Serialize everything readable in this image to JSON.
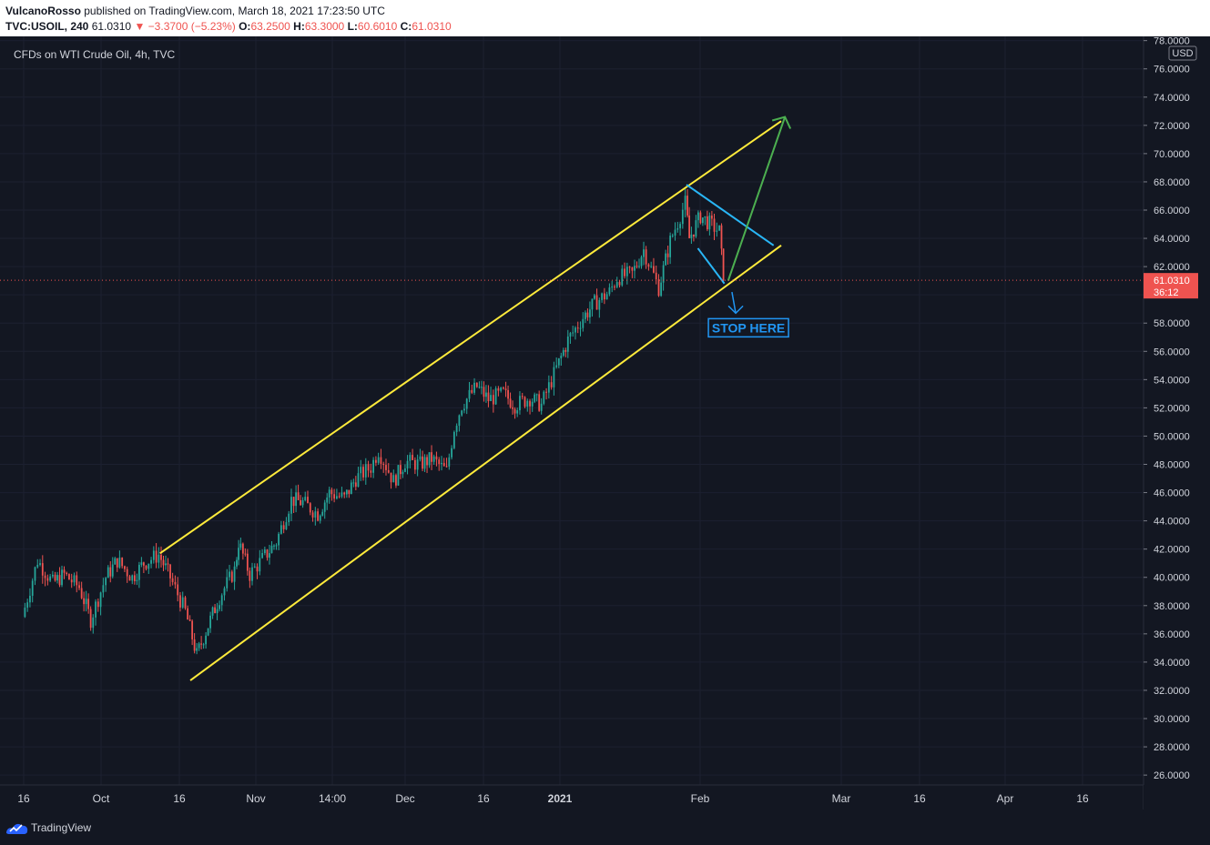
{
  "header": {
    "author": "VulcanoRosso",
    "published_text": "published on TradingView.com, March 18, 2021 17:23:50 UTC",
    "symbol": "TVC:USOIL, 240",
    "last": "61.0310",
    "change": "−3.3700 (−5.23%)",
    "o_label": "O:",
    "o": "63.2500",
    "h_label": "H:",
    "h": "63.3000",
    "l_label": "L:",
    "l": "60.6010",
    "c_label": "C:",
    "c": "61.0310"
  },
  "chart_data": {
    "type": "candlestick",
    "title": "CFDs on WTI Crude Oil, 4h, TVC",
    "y_unit": "USD",
    "ylim": [
      25.3,
      78.3
    ],
    "y_ticks": [
      "78.0000",
      "76.0000",
      "74.0000",
      "72.0000",
      "70.0000",
      "68.0000",
      "66.0000",
      "64.0000",
      "62.0000",
      "60.0000",
      "58.0000",
      "56.0000",
      "54.0000",
      "52.0000",
      "50.0000",
      "48.0000",
      "46.0000",
      "44.0000",
      "42.0000",
      "40.0000",
      "38.0000",
      "36.0000",
      "34.0000",
      "32.0000",
      "30.0000",
      "28.0000",
      "26.0000"
    ],
    "x_ticks": [
      "16",
      "Oct",
      "16",
      "Nov",
      "14:00",
      "Dec",
      "16",
      "2021",
      "Feb",
      "Mar",
      "16",
      "Apr",
      "16"
    ],
    "last_price": {
      "value": 61.031,
      "label": "61.0310",
      "countdown": "36:12"
    },
    "price_path": [
      {
        "date": "2020-09-14",
        "close": 37.2
      },
      {
        "date": "2020-09-18",
        "close": 41.2
      },
      {
        "date": "2020-09-22",
        "close": 39.6
      },
      {
        "date": "2020-09-25",
        "close": 40.2
      },
      {
        "date": "2020-09-29",
        "close": 39.3
      },
      {
        "date": "2020-10-02",
        "close": 37.0
      },
      {
        "date": "2020-10-06",
        "close": 40.0
      },
      {
        "date": "2020-10-09",
        "close": 41.2
      },
      {
        "date": "2020-10-13",
        "close": 40.0
      },
      {
        "date": "2020-10-16",
        "close": 41.0
      },
      {
        "date": "2020-10-20",
        "close": 41.6
      },
      {
        "date": "2020-10-23",
        "close": 40.0
      },
      {
        "date": "2020-10-27",
        "close": 37.6
      },
      {
        "date": "2020-10-30",
        "close": 34.5
      },
      {
        "date": "2020-11-02",
        "close": 36.6
      },
      {
        "date": "2020-11-05",
        "close": 38.6
      },
      {
        "date": "2020-11-09",
        "close": 40.5
      },
      {
        "date": "2020-11-10",
        "close": 42.5
      },
      {
        "date": "2020-11-13",
        "close": 40.2
      },
      {
        "date": "2020-11-17",
        "close": 41.5
      },
      {
        "date": "2020-11-20",
        "close": 42.5
      },
      {
        "date": "2020-11-24",
        "close": 45.5
      },
      {
        "date": "2020-11-27",
        "close": 45.3
      },
      {
        "date": "2020-12-01",
        "close": 44.5
      },
      {
        "date": "2020-12-04",
        "close": 46.0
      },
      {
        "date": "2020-12-08",
        "close": 45.6
      },
      {
        "date": "2020-12-11",
        "close": 47.0
      },
      {
        "date": "2020-12-15",
        "close": 47.8
      },
      {
        "date": "2020-12-17",
        "close": 49.0
      },
      {
        "date": "2020-12-21",
        "close": 46.8
      },
      {
        "date": "2020-12-24",
        "close": 48.2
      },
      {
        "date": "2020-12-28",
        "close": 48.0
      },
      {
        "date": "2020-12-31",
        "close": 48.4
      },
      {
        "date": "2021-01-04",
        "close": 47.5
      },
      {
        "date": "2021-01-06",
        "close": 50.6
      },
      {
        "date": "2021-01-08",
        "close": 52.2
      },
      {
        "date": "2021-01-12",
        "close": 53.5
      },
      {
        "date": "2021-01-15",
        "close": 52.6
      },
      {
        "date": "2021-01-19",
        "close": 53.0
      },
      {
        "date": "2021-01-22",
        "close": 52.2
      },
      {
        "date": "2021-01-26",
        "close": 52.7
      },
      {
        "date": "2021-01-29",
        "close": 52.2
      },
      {
        "date": "2021-02-02",
        "close": 54.8
      },
      {
        "date": "2021-02-05",
        "close": 56.8
      },
      {
        "date": "2021-02-09",
        "close": 58.4
      },
      {
        "date": "2021-02-12",
        "close": 59.4
      },
      {
        "date": "2021-02-16",
        "close": 60.2
      },
      {
        "date": "2021-02-18",
        "close": 61.2
      },
      {
        "date": "2021-02-22",
        "close": 61.5
      },
      {
        "date": "2021-02-25",
        "close": 63.2
      },
      {
        "date": "2021-03-01",
        "close": 60.5
      },
      {
        "date": "2021-03-04",
        "close": 63.8
      },
      {
        "date": "2021-03-08",
        "close": 66.5
      },
      {
        "date": "2021-03-09",
        "close": 64.0
      },
      {
        "date": "2021-03-12",
        "close": 65.6
      },
      {
        "date": "2021-03-15",
        "close": 64.9
      },
      {
        "date": "2021-03-17",
        "close": 64.5
      },
      {
        "date": "2021-03-18",
        "close": 61.0
      }
    ],
    "annotations": {
      "channel_upper": [
        {
          "date": "2020-10-20",
          "price": 41.7
        },
        {
          "date": "2021-04-02",
          "price": 72.3
        }
      ],
      "channel_lower": [
        {
          "date": "2020-10-28",
          "price": 32.7
        },
        {
          "date": "2021-04-02",
          "price": 63.5
        }
      ],
      "flag_upper": [
        {
          "date": "2021-03-08",
          "price": 67.8
        },
        {
          "date": "2021-03-31",
          "price": 63.5
        }
      ],
      "flag_lower": [
        {
          "date": "2021-03-11",
          "price": 63.3
        },
        {
          "date": "2021-03-18",
          "price": 60.8
        }
      ],
      "target_arrow": [
        {
          "date": "2021-03-19",
          "price": 61.0
        },
        {
          "date": "2021-04-03",
          "price": 72.6
        }
      ],
      "stop_arrow": [
        {
          "date": "2021-03-20",
          "price": 60.2
        },
        {
          "date": "2021-03-21",
          "price": 58.7
        }
      ],
      "stop_label": "STOP HERE"
    },
    "colors": {
      "up": "#26a69a",
      "down": "#ef5350",
      "channel": "#ffeb3b",
      "flag": "#29b6f6",
      "target": "#4caf50",
      "stop": "#2196f3",
      "background": "#131722"
    }
  },
  "footer": {
    "brand": "TradingView"
  }
}
